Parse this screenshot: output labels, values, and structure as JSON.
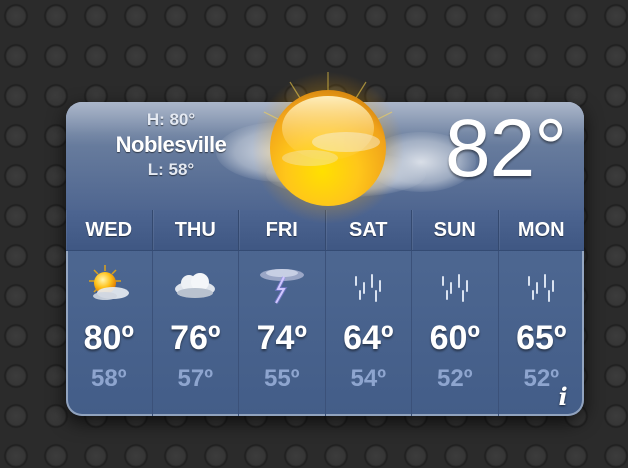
{
  "widget": {
    "city": "Noblesville",
    "high": "H: 80°",
    "low": "L: 58°",
    "current_temp": "82°",
    "current_condition_icon": "sunny-partly-cloudy-icon",
    "info_label": "i"
  },
  "forecast": [
    {
      "day": "WED",
      "high": "80º",
      "low": "58º",
      "icon": "sun-partly-cloudy-icon"
    },
    {
      "day": "THU",
      "high": "76º",
      "low": "57º",
      "icon": "cloudy-icon"
    },
    {
      "day": "FRI",
      "high": "74º",
      "low": "55º",
      "icon": "thunderstorm-icon"
    },
    {
      "day": "SAT",
      "high": "64º",
      "low": "54º",
      "icon": "rain-icon"
    },
    {
      "day": "SUN",
      "high": "60º",
      "low": "52º",
      "icon": "rain-icon"
    },
    {
      "day": "MON",
      "high": "65º",
      "low": "52º",
      "icon": "rain-icon"
    }
  ],
  "colors": {
    "background": "#2b2b2b",
    "widget_blue": "#4e6892",
    "low_temp": "#8ea5cf",
    "sun_yellow": "#ffd21a"
  }
}
